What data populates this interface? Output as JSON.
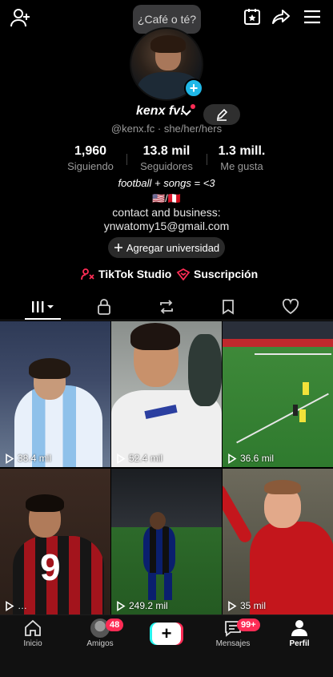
{
  "topbar": {
    "bubble_text": "¿Café o té?"
  },
  "profile": {
    "name": "kenx fv!",
    "handle_line": "@kenx.fc · she/her/hers",
    "stats": [
      {
        "value": "1,960",
        "label": "Siguiendo"
      },
      {
        "value": "13.8 mil",
        "label": "Seguidores"
      },
      {
        "value": "1.3 mill.",
        "label": "Me gusta"
      }
    ],
    "bio": {
      "line1": "football + songs = <3",
      "flags": "🇺🇸/🇵🇪",
      "line3": "contact and business:",
      "line4": "ynwatomy15@gmail.com"
    },
    "university_button": "Agregar universidad",
    "studio_link": "TikTok Studio",
    "subscription_link": "Suscripción"
  },
  "videos": [
    {
      "views": "38.4 mil"
    },
    {
      "views": "52.4 mil"
    },
    {
      "views": "36.6 mil"
    },
    {
      "views": "…"
    },
    {
      "views": "249.2 mil"
    },
    {
      "views": "35 mil"
    }
  ],
  "bottom_nav": {
    "home": "Inicio",
    "friends": "Amigos",
    "friends_badge": "48",
    "messages": "Mensajes",
    "messages_badge": "99+",
    "profile": "Perfil"
  },
  "colors": {
    "accent_red": "#fe2c55",
    "accent_cyan": "#25f4ee",
    "badge_blue": "#20b8e8"
  },
  "icons": [
    "add-user-icon",
    "calendar-star-icon",
    "share-icon",
    "menu-icon",
    "edit-icon",
    "plus-icon",
    "studio-icon",
    "subscription-icon",
    "grid-icon",
    "lock-icon",
    "repost-icon",
    "bookmark-icon",
    "heart-icon",
    "play-icon",
    "home-icon",
    "friends-icon",
    "messages-icon",
    "profile-icon"
  ]
}
